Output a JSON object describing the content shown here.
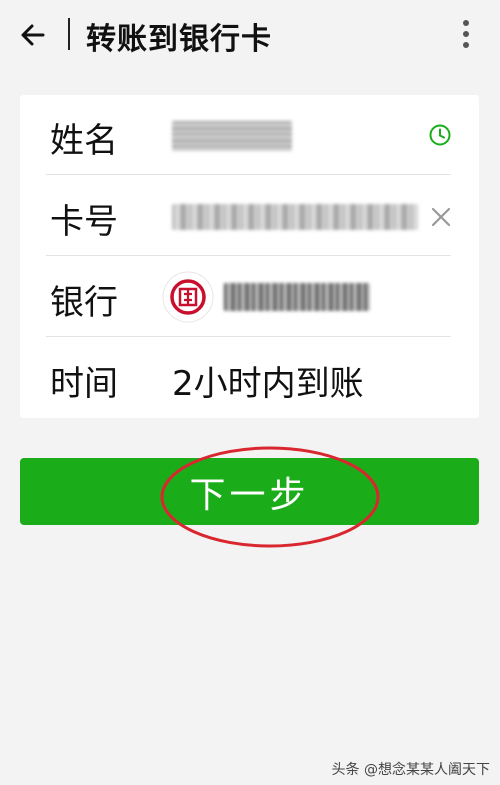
{
  "header": {
    "title": "转账到银行卡",
    "back_icon": "arrow-left-icon",
    "more_icon": "more-vertical-icon"
  },
  "form": {
    "name": {
      "label": "姓名",
      "value_redacted": true,
      "icon": "clock-icon"
    },
    "card_number": {
      "label": "卡号",
      "value_redacted": true,
      "icon": "close-icon"
    },
    "bank": {
      "label": "银行",
      "logo_icon": "bank-logo-icon",
      "value_redacted": true
    },
    "time": {
      "label": "时间",
      "value": "2小时内到账"
    }
  },
  "actions": {
    "next_label": "下一步"
  },
  "watermark": "头条 @想念某某人阖天下",
  "colors": {
    "primary_green": "#1aad19",
    "annotation_red": "#d9262f",
    "bank_red": "#c8102e"
  }
}
